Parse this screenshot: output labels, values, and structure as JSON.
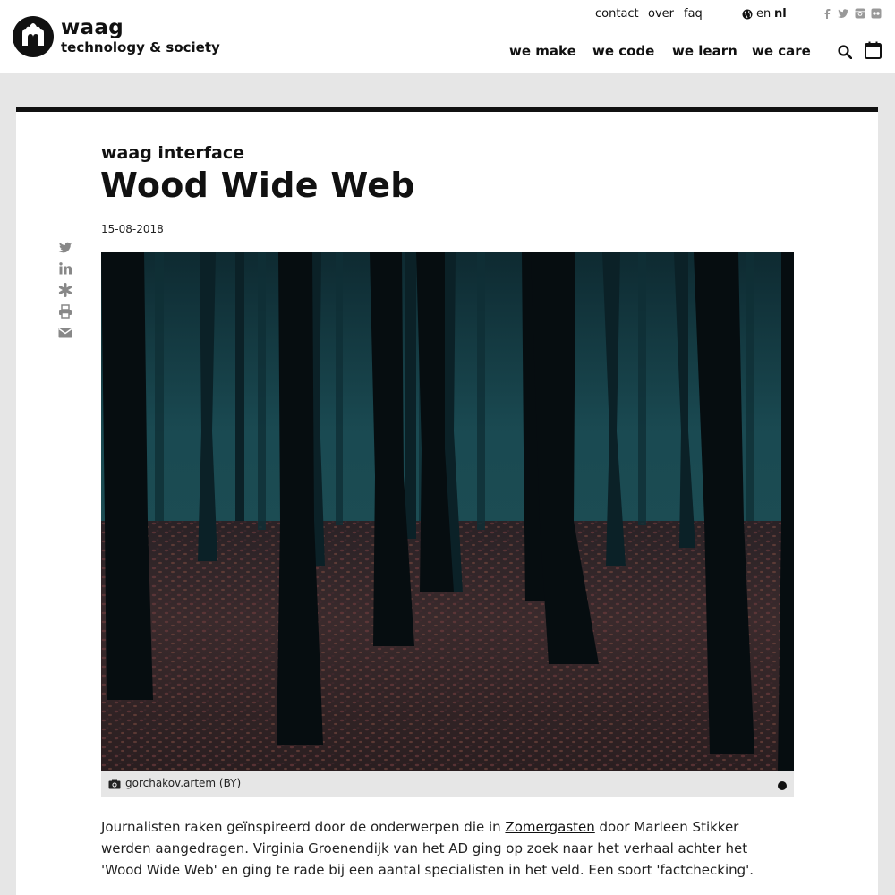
{
  "brand": {
    "name": "waag",
    "tagline": "technology & society"
  },
  "top_links": [
    "contact",
    "over",
    "faq"
  ],
  "languages": {
    "en": "en",
    "nl": "nl",
    "active": "nl"
  },
  "social_icons": [
    "facebook-icon",
    "twitter-icon",
    "instagram-icon",
    "flickr-icon"
  ],
  "nav": [
    "we make",
    "we code",
    "we learn",
    "we care"
  ],
  "header_icons": [
    "search-icon",
    "calendar-icon"
  ],
  "article": {
    "kicker": "waag interface",
    "title": "Wood Wide Web",
    "date": "15-08-2018",
    "share_icons": [
      "twitter-icon",
      "linkedin-icon",
      "asterisk-icon",
      "print-icon",
      "email-icon"
    ],
    "caption": "gorchakov.artem (BY)",
    "body_before_link": "Journalisten raken geïnspireerd door de onderwerpen die in ",
    "link_text": "Zomergasten",
    "body_after_link": " door Marleen Stikker werden aangedragen. Virginia Groenendijk van het AD ging op zoek naar het verhaal achter het 'Wood Wide Web' en ging te rade bij een aantal specialisten in het veld. Een soort 'factchecking'."
  },
  "colors": {
    "accent": "#111111",
    "background": "#e6e6e6",
    "icon_grey": "#999999"
  }
}
